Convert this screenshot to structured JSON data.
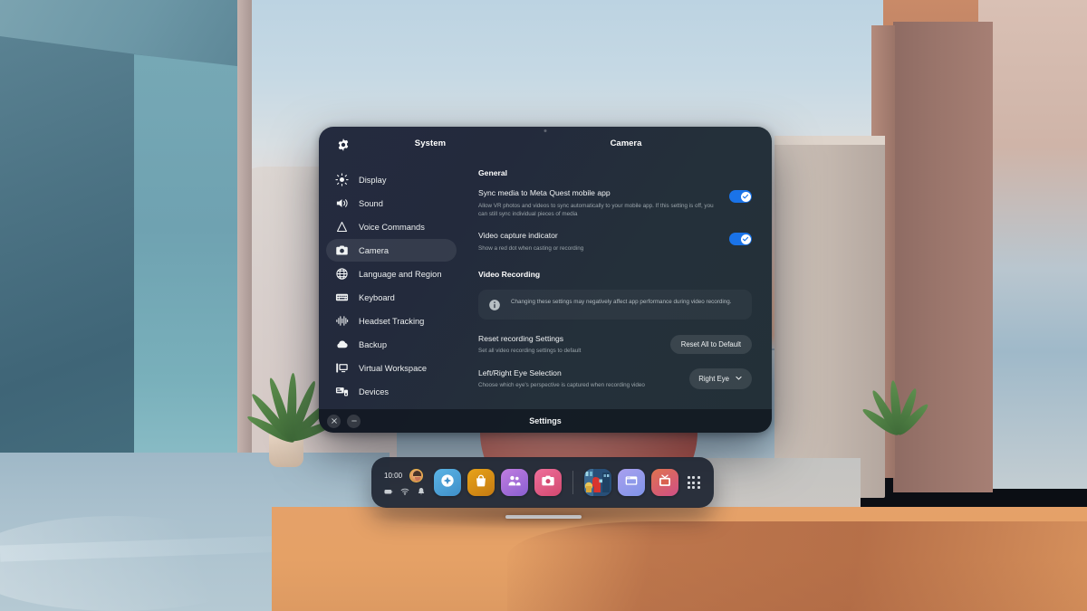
{
  "window": {
    "app_title": "System",
    "page_title": "Camera",
    "footer_title": "Settings",
    "gear_icon": "gear-icon",
    "close_label": "Close",
    "minimize_label": "Minimize"
  },
  "sidebar": {
    "items": [
      {
        "label": "Display",
        "icon": "brightness-icon",
        "active": false
      },
      {
        "label": "Sound",
        "icon": "speaker-icon",
        "active": false
      },
      {
        "label": "Voice Commands",
        "icon": "voice-commands-icon",
        "active": false
      },
      {
        "label": "Camera",
        "icon": "camera-icon",
        "active": true
      },
      {
        "label": "Language and Region",
        "icon": "globe-icon",
        "active": false
      },
      {
        "label": "Keyboard",
        "icon": "keyboard-icon",
        "active": false
      },
      {
        "label": "Headset Tracking",
        "icon": "waveform-icon",
        "active": false
      },
      {
        "label": "Backup",
        "icon": "cloud-icon",
        "active": false
      },
      {
        "label": "Virtual Workspace",
        "icon": "monitor-icon",
        "active": false
      },
      {
        "label": "Devices",
        "icon": "devices-icon",
        "active": false
      }
    ]
  },
  "content": {
    "general_heading": "General",
    "video_recording_heading": "Video Recording",
    "settings": [
      {
        "title": "Sync media to Meta Quest mobile app",
        "subtitle": "Allow VR photos and videos to sync automatically to your mobile app. If this setting is off, you can still sync individual pieces of media",
        "control": "toggle",
        "value": "on"
      },
      {
        "title": "Video capture indicator",
        "subtitle": "Show a red dot when casting or recording",
        "control": "toggle",
        "value": "on"
      }
    ],
    "info_notice": {
      "icon": "info-icon",
      "text": "Changing these settings may negatively affect app performance during video recording."
    },
    "recording_settings": [
      {
        "title": "Reset recording Settings",
        "subtitle": "Set all video recording settings to default",
        "control": "button",
        "button_label": "Reset All to Default"
      },
      {
        "title": "Left/Right Eye Selection",
        "subtitle": "Choose which eye's perspective is captured when recording video",
        "control": "dropdown",
        "value": "Right Eye"
      }
    ]
  },
  "dock": {
    "clock": "10:00",
    "avatar": "user-avatar",
    "status_icons": [
      "battery-icon",
      "wifi-icon",
      "notification-bell-icon"
    ],
    "apps": [
      {
        "name": "explore-app",
        "icon": "compass-icon",
        "color_start": "#5bb4e5",
        "color_end": "#3f8fc9",
        "running": false
      },
      {
        "name": "store-app",
        "icon": "shopping-bag-icon",
        "color_start": "#e8a319",
        "color_end": "#c47a12",
        "running": false
      },
      {
        "name": "people-app",
        "icon": "people-icon",
        "color_start": "#c07de0",
        "color_end": "#8a5fd0",
        "running": false
      },
      {
        "name": "camera-app",
        "icon": "camera-icon",
        "color_start": "#ef6f9b",
        "color_end": "#d2486f",
        "running": true
      },
      {
        "name": "among-us-game",
        "icon": "game-thumbnail",
        "color_start": "#2a5a86",
        "color_end": "#1c3d5e",
        "running": false
      },
      {
        "name": "browser-app",
        "icon": "browser-window-icon",
        "color_start": "#a9a0ef",
        "color_end": "#7f94e8",
        "running": false
      },
      {
        "name": "tv-app",
        "icon": "television-icon",
        "color_start": "#e0734f",
        "color_end": "#cf4f86",
        "running": false
      }
    ],
    "app_library_label": "app-grid"
  },
  "colors": {
    "accent_blue": "#1a73e8",
    "panel_bg": "#242b3f",
    "text_primary": "#f2f4f5",
    "text_secondary": "#9aa4aa"
  }
}
